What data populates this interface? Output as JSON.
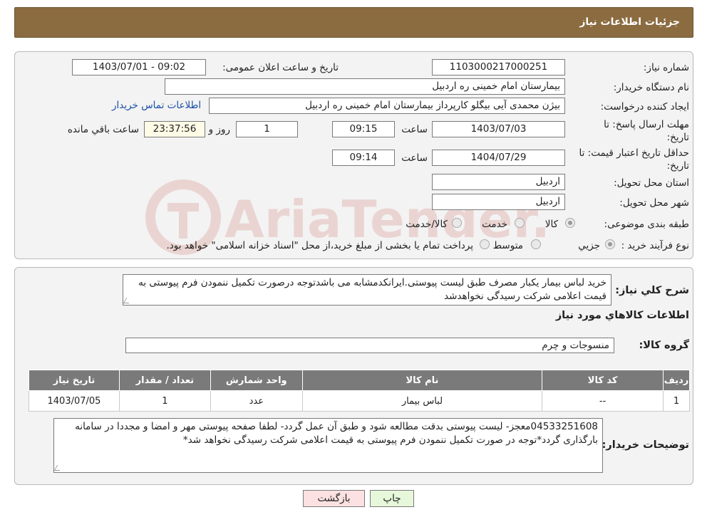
{
  "header": {
    "title": "جزئیات اطلاعات نیاز"
  },
  "watermark": {
    "text": "AriaTender.neT",
    "color": "#c0392b"
  },
  "form": {
    "need_number_label": "شماره نیاز:",
    "need_number": "1103000217000251",
    "announce_label": "تاریخ و ساعت اعلان عمومی:",
    "announce_value": "1403/07/01 - 09:02",
    "buyer_org_label": "نام دستگاه خریدار:",
    "buyer_org": "بیمارستان امام خمینی  ره  اردبیل",
    "creator_label": "ایجاد کننده درخواست:",
    "creator": "بیژن محمدی آیی بیگلو کارپرداز بیمارستان امام خمینی  ره  اردبیل",
    "contact_link": "اطلاعات تماس خریدار",
    "deadline_label": "مهلت ارسال پاسخ: تا تاریخ:",
    "deadline_date": "1403/07/03",
    "time_label": "ساعت",
    "deadline_time": "09:15",
    "days_value": "1",
    "days_label": "روز و",
    "remaining_time": "23:37:56",
    "remaining_label": "ساعت باقي مانده",
    "validity_label": "حداقل تاریخ اعتبار قیمت: تا تاریخ:",
    "validity_date": "1404/07/29",
    "validity_time": "09:14",
    "province_label": "استان محل تحویل:",
    "province": "اردبیل",
    "city_label": "شهر محل تحویل:",
    "city": "اردبیل",
    "category_label": "طبقه بندی موضوعی:",
    "category_options": [
      "کالا",
      "خدمت",
      "کالا/خدمت"
    ],
    "purchase_type_label": "نوع فرآیند خرید :",
    "purchase_options": [
      "جزیي",
      "متوسط"
    ],
    "purchase_note": "پرداخت تمام یا بخشی از مبلغ خرید،از محل \"اسناد خزانه اسلامی\" خواهد بود."
  },
  "summary": {
    "desc_label": "شرح کلي نياز:",
    "desc": "خرید لباس بیمار یکبار مصرف طبق لیست پیوستی.ایرانکدمشابه می باشدتوجه درصورت تکمیل ننمودن فرم پیوستی به قیمت اعلامی شرکت رسیدگی نخواهدشد",
    "goods_info_title": "اطلاعات کالاهاي مورد نياز",
    "group_label": "گروه کالا:",
    "group": "منسوجات و چرم"
  },
  "table": {
    "headers": [
      "ردیف",
      "کد کالا",
      "نام کالا",
      "واحد شمارش",
      "تعداد / مقدار",
      "تاریخ نیاز"
    ],
    "rows": [
      [
        "1",
        "--",
        "لباس بیمار",
        "عدد",
        "1",
        "1403/07/05"
      ]
    ]
  },
  "buyer_notes": {
    "label": "توضیحات خریدار:",
    "text": "04533251608معجز- لیست پیوستی بدقت مطالعه شود و طبق آن عمل گردد- لطفا صفحه پیوستی مهر و امضا و مجددا در سامانه بارگذاری گردد*توجه در صورت تکمیل ننمودن فرم پیوستی به قیمت اعلامی شرکت رسیدگی نخواهد شد*"
  },
  "buttons": {
    "print": "چاپ",
    "back": "بازگشت"
  },
  "colors": {
    "header": "#8b6b40",
    "print_bg": "#e6f7da",
    "back_bg": "#fbe1e1",
    "table_header": "#7a7a7a"
  }
}
